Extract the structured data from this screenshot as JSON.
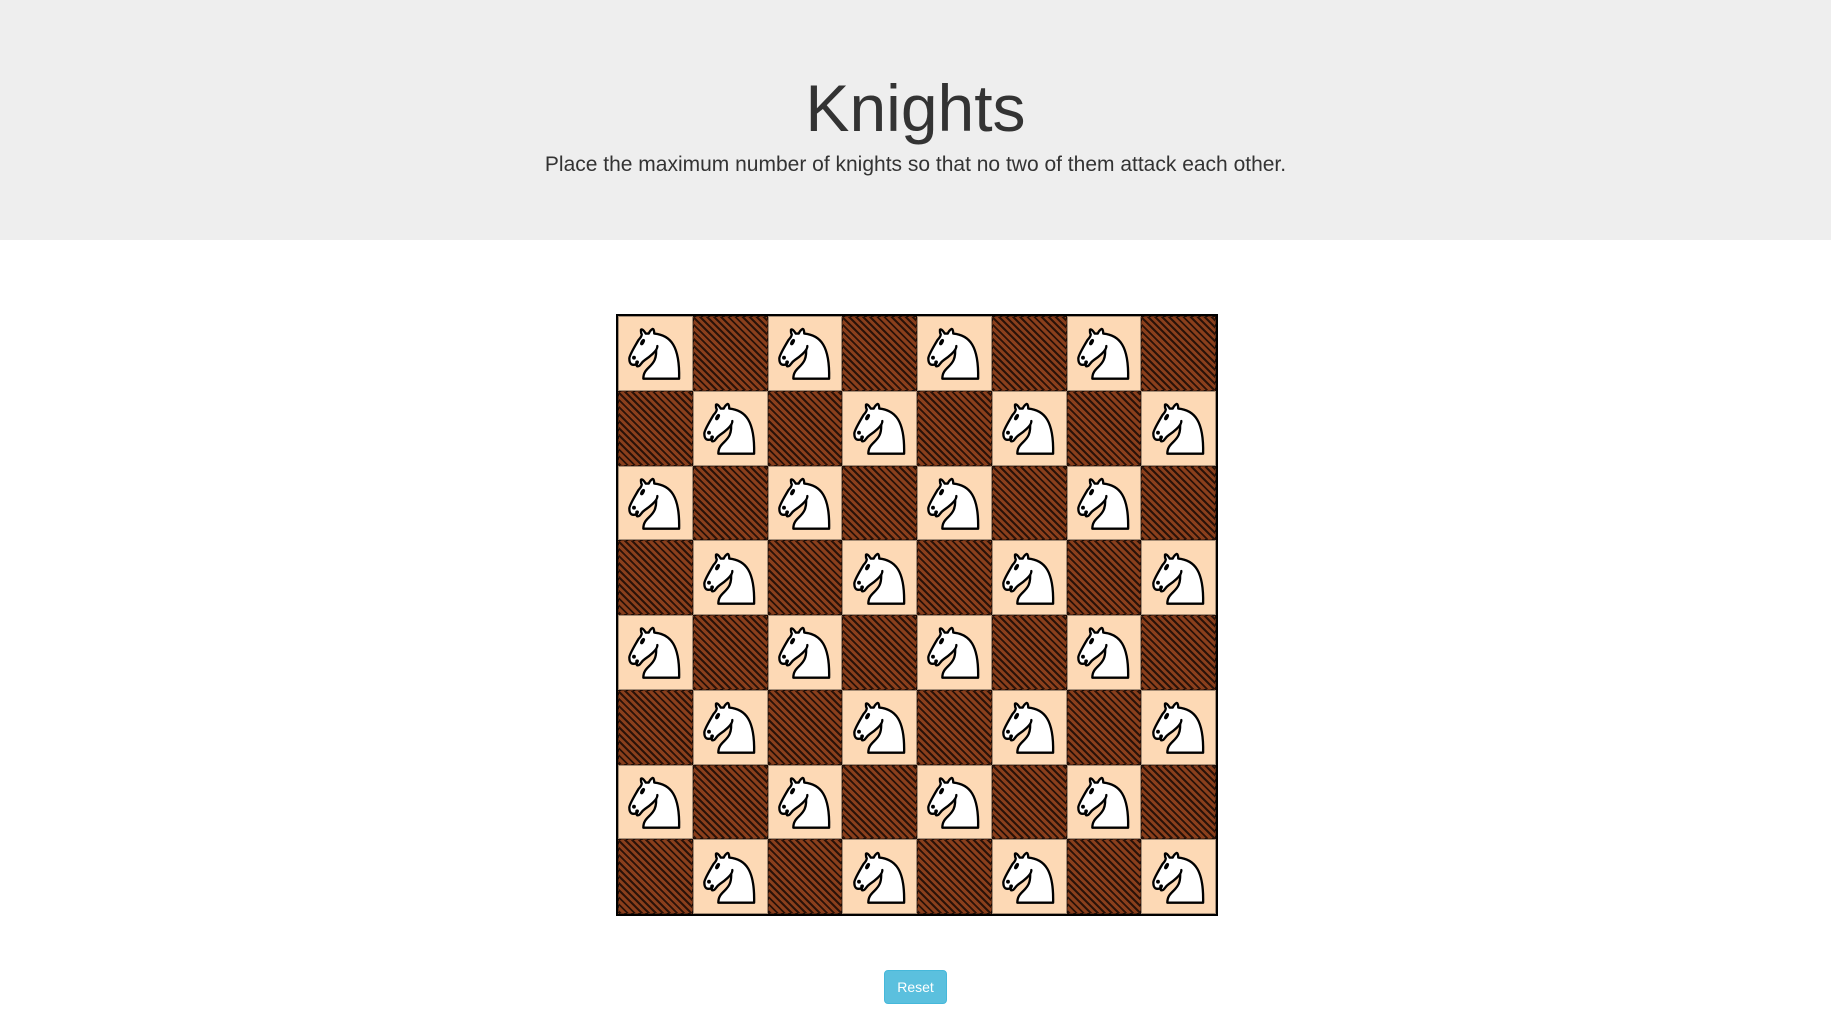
{
  "header": {
    "title": "Knights",
    "subtitle": "Place the maximum number of knights so that no two of them attack each other."
  },
  "board": {
    "size": 8,
    "light_color": "#fdd9b5",
    "dark_color": "#5a2a12",
    "piece_icon": "white-knight-icon",
    "knights": [
      [
        1,
        0,
        1,
        0,
        1,
        0,
        1,
        0
      ],
      [
        0,
        1,
        0,
        1,
        0,
        1,
        0,
        1
      ],
      [
        1,
        0,
        1,
        0,
        1,
        0,
        1,
        0
      ],
      [
        0,
        1,
        0,
        1,
        0,
        1,
        0,
        1
      ],
      [
        1,
        0,
        1,
        0,
        1,
        0,
        1,
        0
      ],
      [
        0,
        1,
        0,
        1,
        0,
        1,
        0,
        1
      ],
      [
        1,
        0,
        1,
        0,
        1,
        0,
        1,
        0
      ],
      [
        0,
        1,
        0,
        1,
        0,
        1,
        0,
        1
      ]
    ]
  },
  "controls": {
    "reset_label": "Reset",
    "reset_color": "#5bc0de"
  }
}
